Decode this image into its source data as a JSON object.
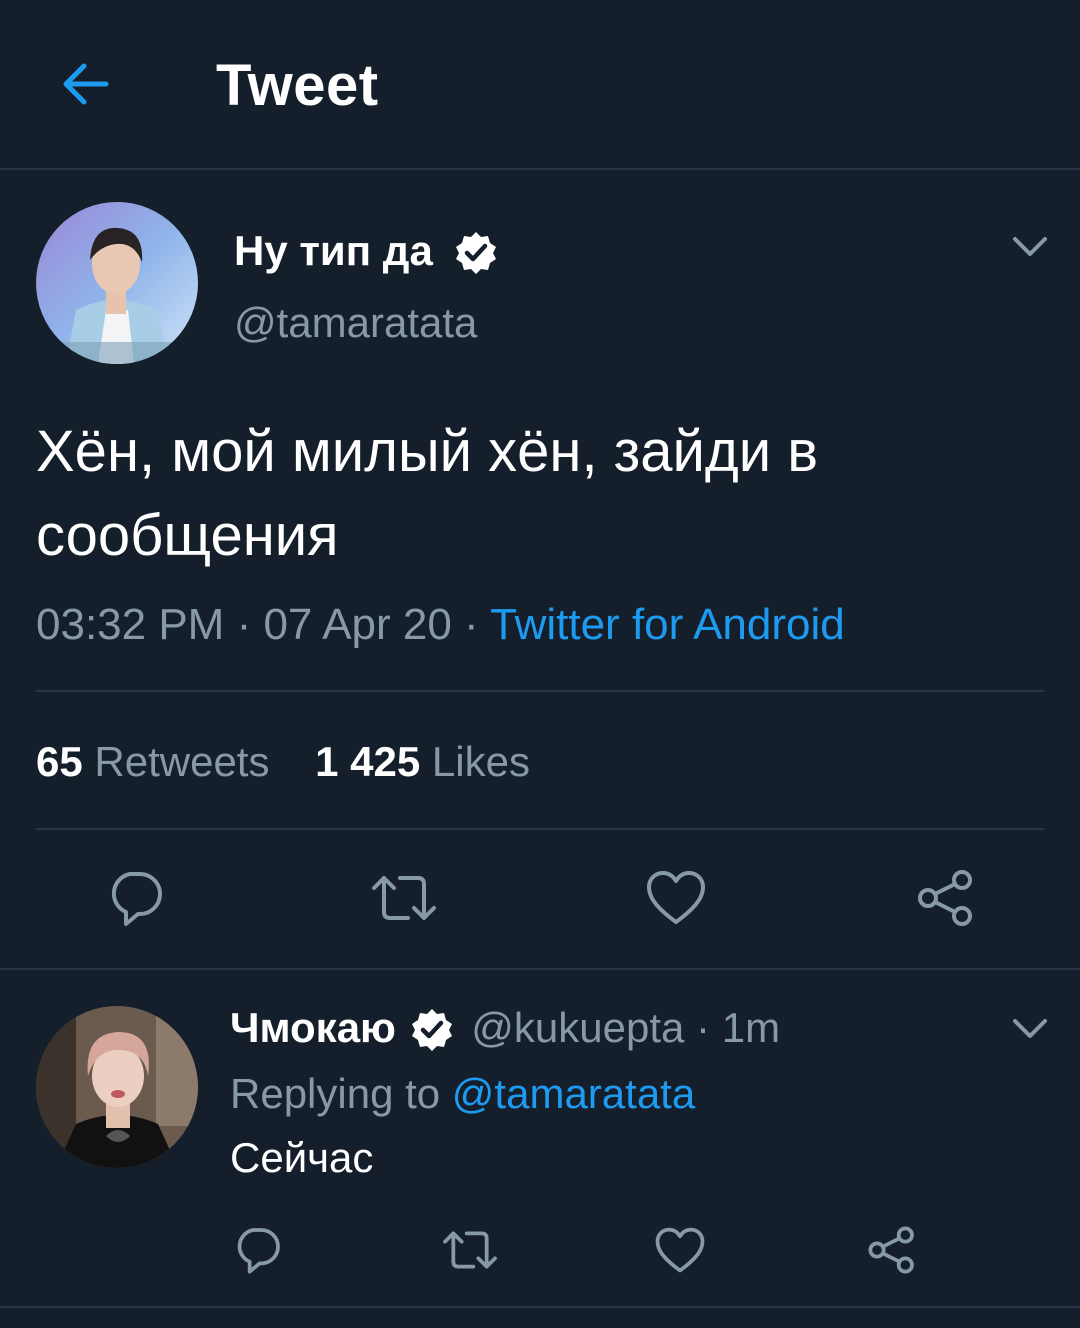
{
  "header": {
    "title": "Tweet",
    "back_icon": "arrow-left-icon"
  },
  "tweet": {
    "author_name": "Ну тип да",
    "author_handle": "@tamaratata",
    "verified": true,
    "text": "Хён, мой милый хён, зайди в сообщения",
    "time": "03:32 PM",
    "separator": " · ",
    "date": "07 Apr 20",
    "source": "Twitter for Android",
    "retweets_count": "65",
    "retweets_label": "Retweets",
    "likes_count": "1 425",
    "likes_label": "Likes"
  },
  "reply": {
    "author_name": "Чмокаю",
    "author_handle": "@kukuepta",
    "time": "1m",
    "separator": " · ",
    "replying_prefix": "Replying to ",
    "replying_to": "@tamaratata",
    "text": "Сейчас"
  },
  "colors": {
    "background": "#151e2b",
    "accent": "#1d9bf0",
    "secondary_text": "#8899a6",
    "divider": "#283444"
  },
  "icons": [
    "arrow-left-icon",
    "verified-badge-icon",
    "chevron-down-icon",
    "reply-icon",
    "retweet-icon",
    "like-icon",
    "share-icon"
  ]
}
